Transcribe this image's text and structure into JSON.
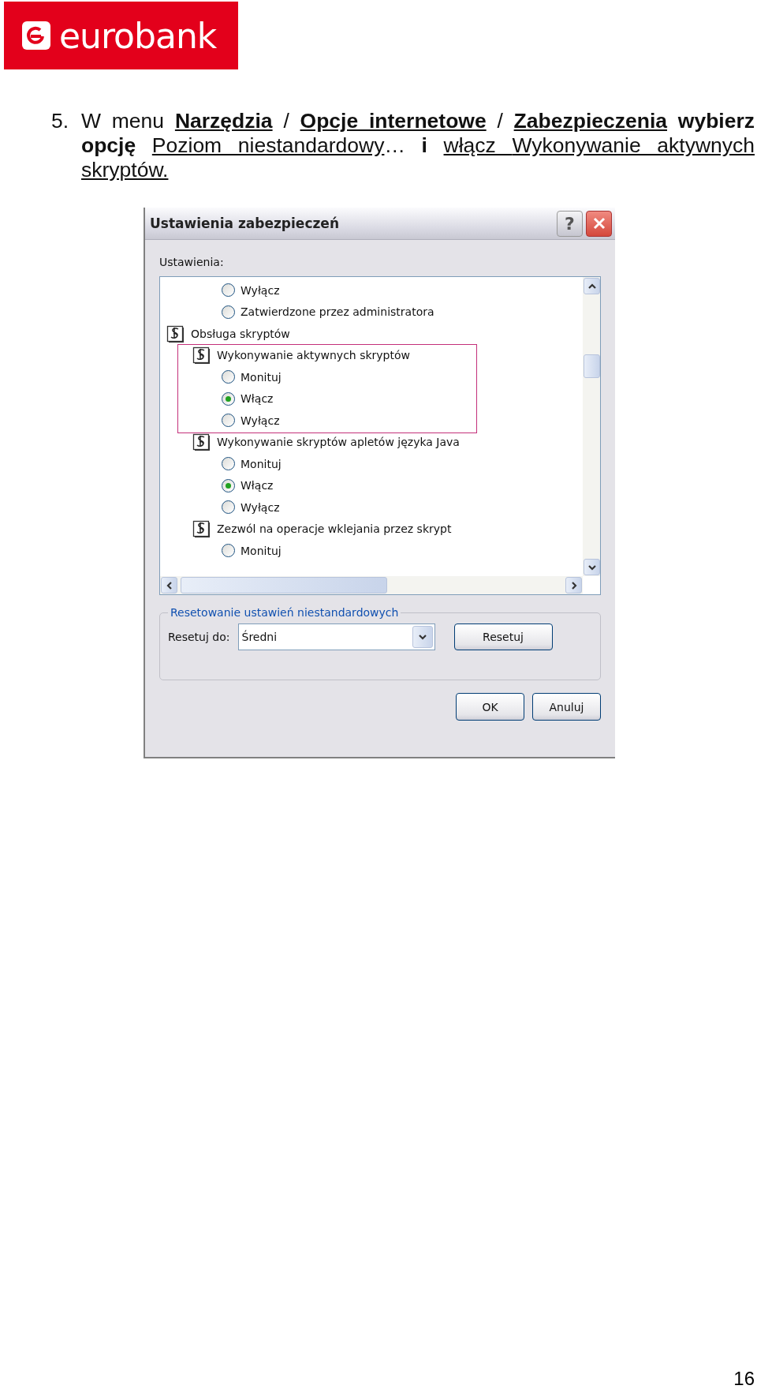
{
  "logo": {
    "text": "eurobank"
  },
  "instruction": {
    "number": "5.",
    "segments": [
      {
        "text": "W menu ",
        "bold": false,
        "underline": false
      },
      {
        "text": "Narzędzia",
        "bold": true,
        "underline": true
      },
      {
        "text": " / ",
        "bold": false,
        "underline": false
      },
      {
        "text": "Opcje internetowe",
        "bold": true,
        "underline": true
      },
      {
        "text": " / ",
        "bold": false,
        "underline": false
      },
      {
        "text": "Zabezpieczenia",
        "bold": true,
        "underline": true
      },
      {
        "text": " wybierz opcję ",
        "bold": true,
        "underline": false
      },
      {
        "text": "Poziom niestandardowy",
        "bold": false,
        "underline": true
      },
      {
        "text": "… ",
        "bold": false,
        "underline": false
      },
      {
        "text": "i ",
        "bold": true,
        "underline": false
      },
      {
        "text": "włącz ",
        "bold": false,
        "underline": true
      },
      {
        "text": "Wykonywanie aktywnych skryptów.",
        "bold": false,
        "underline": true
      }
    ]
  },
  "dialog": {
    "title": "Ustawienia zabezpieczeń",
    "help_button": "?",
    "settings_label": "Ustawienia:",
    "tree": [
      {
        "kind": "group",
        "children": [
          {
            "kind": "setting",
            "children": [
              {
                "kind": "radio",
                "label": "Wyłącz",
                "selected": false
              },
              {
                "kind": "radio",
                "label": "Zatwierdzone przez administratora",
                "selected": false
              }
            ]
          }
        ]
      },
      {
        "kind": "group",
        "label": "Obsługa skryptów",
        "children": [
          {
            "kind": "setting",
            "label": "Wykonywanie aktywnych skryptów",
            "highlighted": true,
            "children": [
              {
                "kind": "radio",
                "label": "Monituj",
                "selected": false
              },
              {
                "kind": "radio",
                "label": "Włącz",
                "selected": true
              },
              {
                "kind": "radio",
                "label": "Wyłącz",
                "selected": false
              }
            ]
          },
          {
            "kind": "setting",
            "label": "Wykonywanie skryptów apletów języka Java",
            "children": [
              {
                "kind": "radio",
                "label": "Monituj",
                "selected": false
              },
              {
                "kind": "radio",
                "label": "Włącz",
                "selected": true
              },
              {
                "kind": "radio",
                "label": "Wyłącz",
                "selected": false
              }
            ]
          },
          {
            "kind": "setting",
            "label": "Zezwól na operacje wklejania przez skrypt",
            "children": [
              {
                "kind": "radio",
                "label": "Monituj",
                "selected": false
              }
            ]
          }
        ]
      }
    ],
    "reset_group": {
      "legend": "Resetowanie ustawień niestandardowych",
      "label": "Resetuj do:",
      "value": "Średni",
      "button": "Resetuj"
    },
    "buttons": [
      "OK",
      "Anuluj"
    ]
  },
  "page_number": "16"
}
